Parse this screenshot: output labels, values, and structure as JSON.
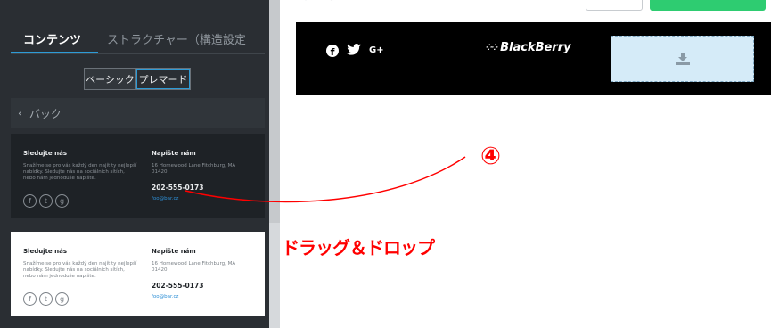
{
  "editor_panel": {
    "tabs": [
      {
        "label": "コンテンツ",
        "active": true
      },
      {
        "label": "ストラクチャー（構造設定",
        "active": false
      }
    ],
    "segmented_control": {
      "basic_label": "ベーシック",
      "premade_label": "プレマード",
      "selected": "プレマード"
    },
    "back_label": "バック",
    "templates": [
      {
        "theme": "dark",
        "follow_heading": "Sledujte nás",
        "follow_text": "Snažíme se pro vás každý den najít ty nejlepší nabídky. Sledujte nás na sociálních sítích, nebo nám jednoduše napište.",
        "contact_heading": "Napište nám",
        "address": "16 Homewood Lane Fitchburg, MA 01420",
        "phone": "202-555-0173",
        "email": "foo@bar.cz",
        "social_icons": [
          "facebook-icon",
          "twitter-icon",
          "google-plus-icon"
        ]
      },
      {
        "theme": "light",
        "follow_heading": "Sledujte nás",
        "follow_text": "Snažíme se pro vás každý den najít ty nejlepší nabídky. Sledujte nás na sociálních sítích, nebo nám jednoduše napište.",
        "contact_heading": "Napište nám",
        "address": "16 Homewood Lane Fitchburg, MA 01420",
        "phone": "202-555-0173",
        "email": "foo@bar.cz",
        "social_icons": [
          "facebook-icon",
          "twitter-icon",
          "google-plus-icon"
        ]
      }
    ]
  },
  "canvas": {
    "footer_block": {
      "social_icons": [
        "facebook-icon",
        "twitter-icon",
        "google-plus-icon"
      ],
      "gplus_glyph": "G+",
      "logo_text": "BlackBerry",
      "image_placeholder_icon": "download-icon"
    }
  },
  "annotation": {
    "step_number": "④",
    "label": "ドラッグ＆ドロップ",
    "color": "#ff0000"
  },
  "colors": {
    "panel_bg": "#2a2e33",
    "accent_blue": "#2d9bd6",
    "green_button": "#2ecc71",
    "footer_bg": "#000000",
    "placeholder_bg": "#d5ebf8"
  }
}
